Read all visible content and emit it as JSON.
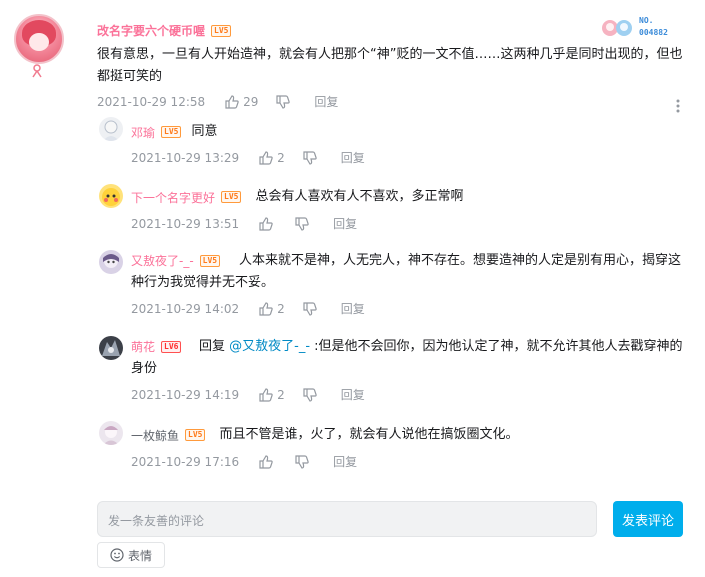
{
  "main_comment": {
    "username": "改名字要六个硬币喔",
    "level": "LV5",
    "text": "很有意思，一旦有人开始造神，就会有人把那个“神”贬的一文不值……这两种几乎是同时出现的，但也都挺可笑的",
    "date": "2021-10-29 12:58",
    "likes": "29",
    "reply_label": "回复",
    "nameplate_label": "NO.",
    "nameplate_number": "004882"
  },
  "replies": [
    {
      "username": "邓瑜",
      "level": "LV5",
      "text": "同意",
      "date": "2021-10-29 13:29",
      "likes": "2",
      "reply_label": "回复"
    },
    {
      "username": "下一个名字更好",
      "level": "LV5",
      "text": "总会有人喜欢有人不喜欢，多正常啊",
      "date": "2021-10-29 13:51",
      "likes": "",
      "reply_label": "回复"
    },
    {
      "username": "又敖夜了-_-",
      "level": "LV5",
      "text": "人本来就不是神，人无完人，神不存在。想要造神的人定是别有用心，揭穿这种行为我觉得并无不妥。",
      "date": "2021-10-29 14:02",
      "likes": "2",
      "reply_label": "回复"
    },
    {
      "username": "萌花",
      "level": "LV6",
      "reply_prefix": "回复 ",
      "mention": "@又敖夜了-_-",
      "text": " :但是他不会回你，因为他认定了神，就不允许其他人去戳穿神的身份",
      "date": "2021-10-29 14:19",
      "likes": "2",
      "reply_label": "回复"
    },
    {
      "username": "一枚鲸鱼",
      "level": "LV5",
      "text": "而且不管是谁，火了，就会有人说他在搞饭圈文化。",
      "date": "2021-10-29 17:16",
      "likes": "",
      "reply_label": "回复"
    }
  ],
  "composer": {
    "placeholder": "发一条友善的评论",
    "submit_label": "发表评论",
    "emoji_label": "表情"
  },
  "icons": [
    "thumb-up-icon",
    "thumb-down-icon",
    "more-vertical-icon",
    "smile-icon"
  ]
}
